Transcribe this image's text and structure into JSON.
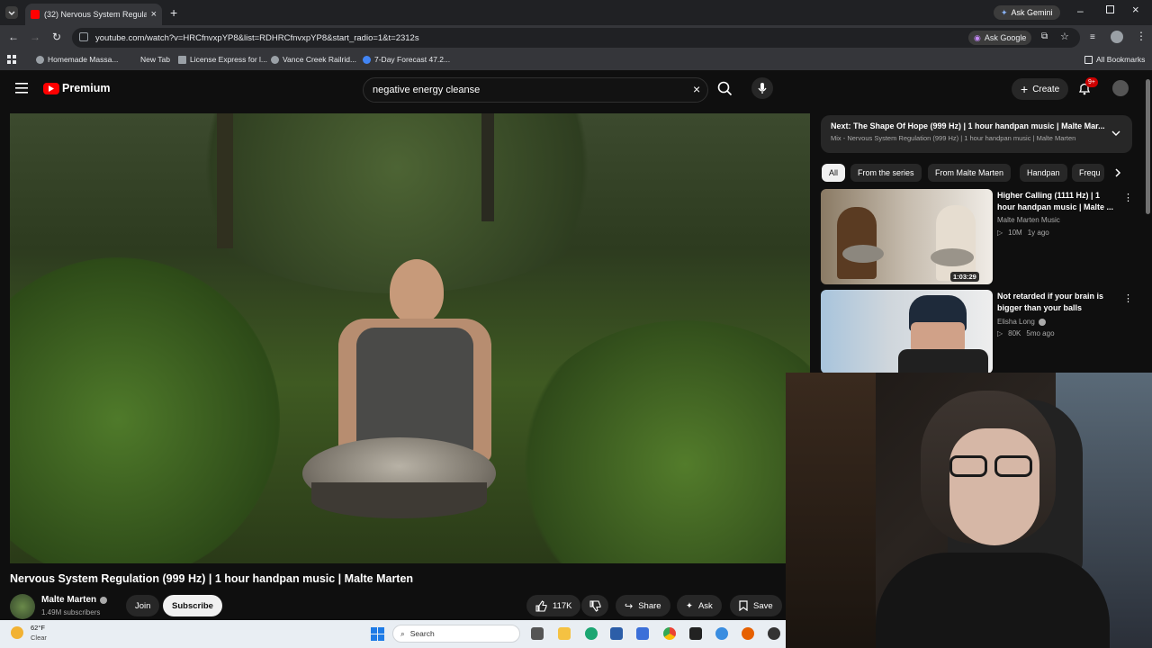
{
  "browser": {
    "tab_title": "(32) Nervous System Regulatio",
    "url": "youtube.com/watch?v=HRCfnvxpYP8&list=RDHRCfnvxpYP8&start_radio=1&t=2312s",
    "ask_gemini": "Ask Gemini",
    "ask_google": "Ask Google",
    "bookmarks": [
      "Homemade Massa...",
      "New Tab",
      "License Express for l...",
      "Vance Creek Railrid...",
      "7-Day Forecast 47.2..."
    ],
    "all_bookmarks": "All Bookmarks"
  },
  "youtube": {
    "logo_text": "Premium",
    "search_value": "negative energy cleanse",
    "create_label": "Create",
    "notification_badge": "9+"
  },
  "video": {
    "title": "Nervous System Regulation (999 Hz) | 1 hour handpan music | Malte Marten",
    "channel": "Malte Marten",
    "subscribers": "1.49M subscribers",
    "join_label": "Join",
    "subscribe_label": "Subscribe",
    "likes": "117K",
    "share_label": "Share",
    "ask_label": "Ask",
    "save_label": "Save"
  },
  "up_next": {
    "next_title": "Next: The Shape Of Hope (999 Hz) | 1 hour handpan music | Malte Mar...",
    "mix_line": "Mix - Nervous System Regulation (999 Hz) | 1 hour handpan music | Malte Marten"
  },
  "chips": [
    "All",
    "From the series",
    "From Malte Marten",
    "Handpan",
    "Frequ"
  ],
  "recommendations": [
    {
      "title_line1": "Higher Calling (1111 Hz) | 1",
      "title_line2": "hour handpan music | Malte ...",
      "channel": "Malte Marten Music",
      "views": "10M",
      "age": "1y ago",
      "duration": "1:03:29"
    },
    {
      "title_line1": "Not retarded if your brain is",
      "title_line2": "bigger than your balls",
      "channel": "Elisha Long",
      "views": "80K",
      "age": "5mo ago"
    }
  ],
  "taskbar": {
    "temperature": "62°F",
    "weather": "Clear",
    "search_label": "Search"
  }
}
